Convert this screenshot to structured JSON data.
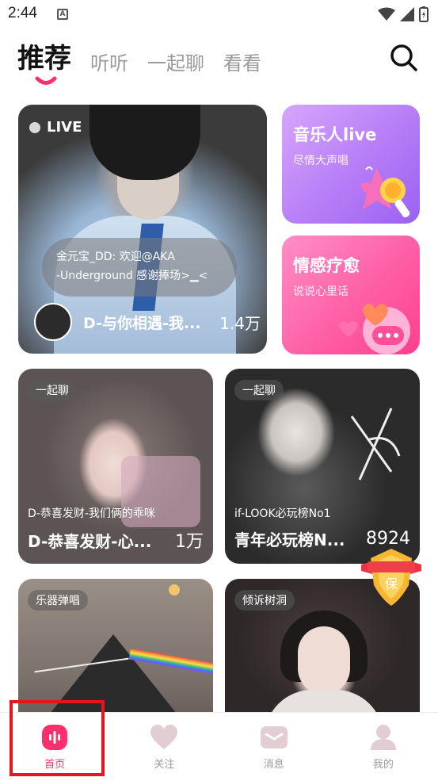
{
  "status_bar": {
    "time": "2:44",
    "notif_letter": "A"
  },
  "top_tabs": [
    {
      "label": "推荐",
      "active": true
    },
    {
      "label": "听听",
      "active": false
    },
    {
      "label": "一起聊",
      "active": false
    },
    {
      "label": "看看",
      "active": false
    }
  ],
  "live_card": {
    "badge": "LIVE",
    "chat_line1": "金元宝_DD: 欢迎@AKA",
    "chat_line2": "-Underground 感谢捧场>▁<",
    "title": "D-与你相遇-我...",
    "count": "1.4万"
  },
  "side_cards": [
    {
      "title": "音乐人live",
      "subtitle": "尽情大声唱"
    },
    {
      "title": "情感疗愈",
      "subtitle": "说说心里话"
    }
  ],
  "room_cards": [
    {
      "tag": "一起聊",
      "subtitle": "D-恭喜发财-我们俩的乖咪",
      "title": "D-恭喜发财-心...",
      "count": "1万"
    },
    {
      "tag": "一起聊",
      "subtitle": "if-LOOK必玩榜No1",
      "title": "青年必玩榜N...",
      "count": "8924"
    },
    {
      "tag": "乐器弹唱",
      "subtitle": "",
      "title": "",
      "count": ""
    },
    {
      "tag": "倾诉树洞",
      "subtitle": "",
      "title": "",
      "count": ""
    }
  ],
  "guard_badge": {
    "text": "保"
  },
  "bottom_nav": [
    {
      "label": "首页",
      "icon": "home-icon",
      "active": true
    },
    {
      "label": "关注",
      "icon": "heart-icon",
      "active": false
    },
    {
      "label": "消息",
      "icon": "message-icon",
      "active": false
    },
    {
      "label": "我的",
      "icon": "profile-icon",
      "active": false
    }
  ],
  "colors": {
    "accent": "#ff2f6d",
    "highlight": "#e8131b"
  }
}
